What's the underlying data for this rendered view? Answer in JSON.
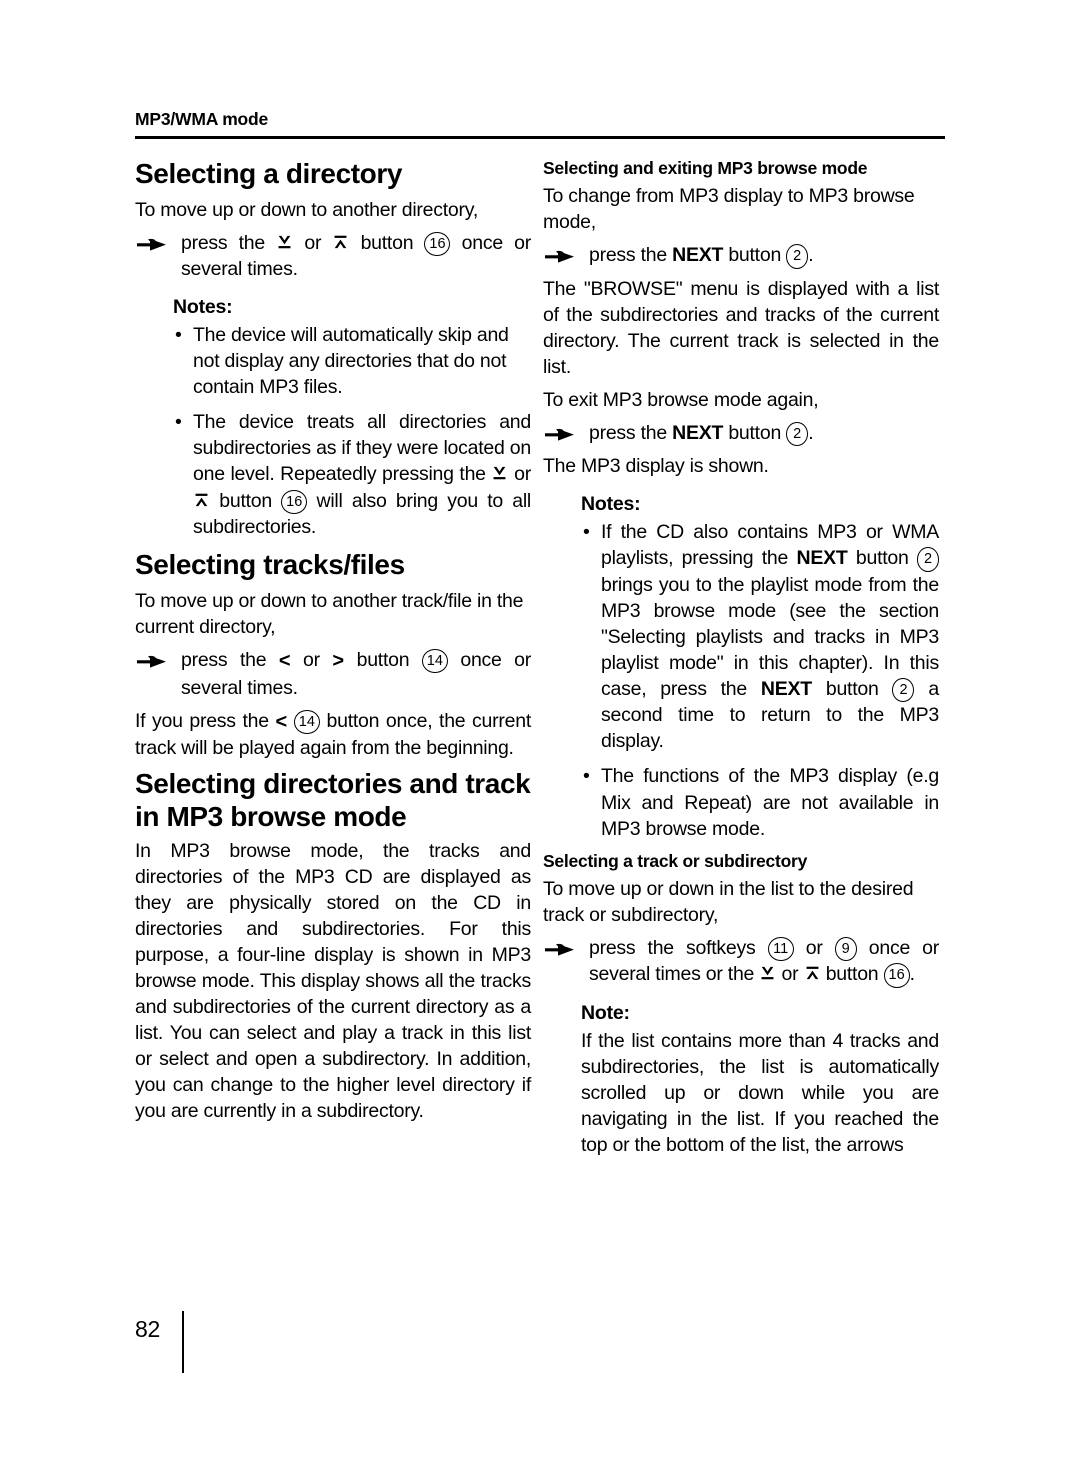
{
  "header": {
    "running_title": "MP3/WMA mode"
  },
  "footer": {
    "page_number": "82"
  },
  "left_column": {
    "section1": {
      "heading": "Selecting a directory",
      "intro": "To move up or down to another directory,",
      "action_pre": "press the",
      "action_mid": "or",
      "action_button_word": "button",
      "action_button_num": "16",
      "action_post": "once or several times.",
      "notes_title": "Notes:",
      "note1": "The device will automatically skip and not display any directories that do not contain MP3 files.",
      "note2_a": "The device treats all directories and subdirectories as if they were located on one level. Repeatedly pressing the",
      "note2_or": "or",
      "note2_button_word": "button",
      "note2_button_num": "16",
      "note2_b": "will also bring you to all subdirectories."
    },
    "section2": {
      "heading": "Selecting tracks/files",
      "intro": "To move up or down to another track/file in the current directory,",
      "action_pre": "press the",
      "action_left_chevron": "<",
      "action_mid": "or",
      "action_right_chevron": ">",
      "action_button_word": "button",
      "action_button_num": "14",
      "action_post": "once or several times.",
      "para_a": "If you press the",
      "para_chevron": "<",
      "para_button_num": "14",
      "para_b": "button once, the current track will be played again from the beginning."
    },
    "section3": {
      "heading_line1": "Selecting directories and track",
      "heading_line2": "in MP3 browse mode",
      "paragraph": "In MP3 browse mode, the tracks and directories of the MP3 CD are displayed as they are physically stored on the CD in directories and subdirectories. For this purpose, a four-line display is shown in MP3 browse mode. This display shows all the tracks and subdirectories of the current directory as a list. You can select and play a track in this list or select and open a subdirectory. In addition, you can change to the higher level directory if you are currently in a subdirectory."
    }
  },
  "right_column": {
    "section1": {
      "heading": "Selecting and exiting MP3 browse mode",
      "intro": "To change from MP3 display to MP3 browse mode,",
      "action_pre": "press the",
      "action_kbd": "NEXT",
      "action_button_word": "button",
      "action_button_num": "2",
      "action_post": ".",
      "para1": "The \"BROWSE\" menu is displayed with a list of the subdirectories and tracks of the current directory. The current track is selected in the list.",
      "para2": "To exit MP3 browse mode again,",
      "action2_pre": "press the",
      "action2_kbd": "NEXT",
      "action2_button_word": "button",
      "action2_button_num": "2",
      "action2_post": ".",
      "para3": "The MP3 display is shown.",
      "notes_title": "Notes:",
      "note1_a": "If the CD also contains MP3 or WMA playlists, pressing the",
      "note1_kbd1": "NEXT",
      "note1_b": "button",
      "note1_num1": "2",
      "note1_c": "brings you to the playlist mode from the MP3 browse mode (see the section \"Selecting playlists and tracks in MP3 playlist mode\" in this chapter). In this case, press the",
      "note1_kbd2": "NEXT",
      "note1_d": "button",
      "note1_num2": "2",
      "note1_e": "a second time to return to the MP3 display.",
      "note2": "The functions of the MP3 display (e.g Mix and Repeat) are not available in MP3 browse mode."
    },
    "section2": {
      "heading": "Selecting a track or subdirectory",
      "intro": "To move up or down in the list to the desired track or subdirectory,",
      "action_pre": "press the softkeys",
      "action_num1": "11",
      "action_or": "or",
      "action_num2": "9",
      "action_mid": "once or several times or the",
      "action_or2": "or",
      "action_button_word": "button",
      "action_num3": "16",
      "action_post": ".",
      "note_title": "Note:",
      "note_text": "If the list contains more than 4 tracks and subdirectories, the list is automatically scrolled up or down while you are navigating in the list. If you reached the top or the bottom of the list, the arrows"
    }
  },
  "icons": {
    "pointing_hand": "pointing-hand-icon",
    "arrow_down_bar": "arrow-down-with-bar-icon",
    "arrow_up_bar": "arrow-up-with-bar-icon"
  }
}
